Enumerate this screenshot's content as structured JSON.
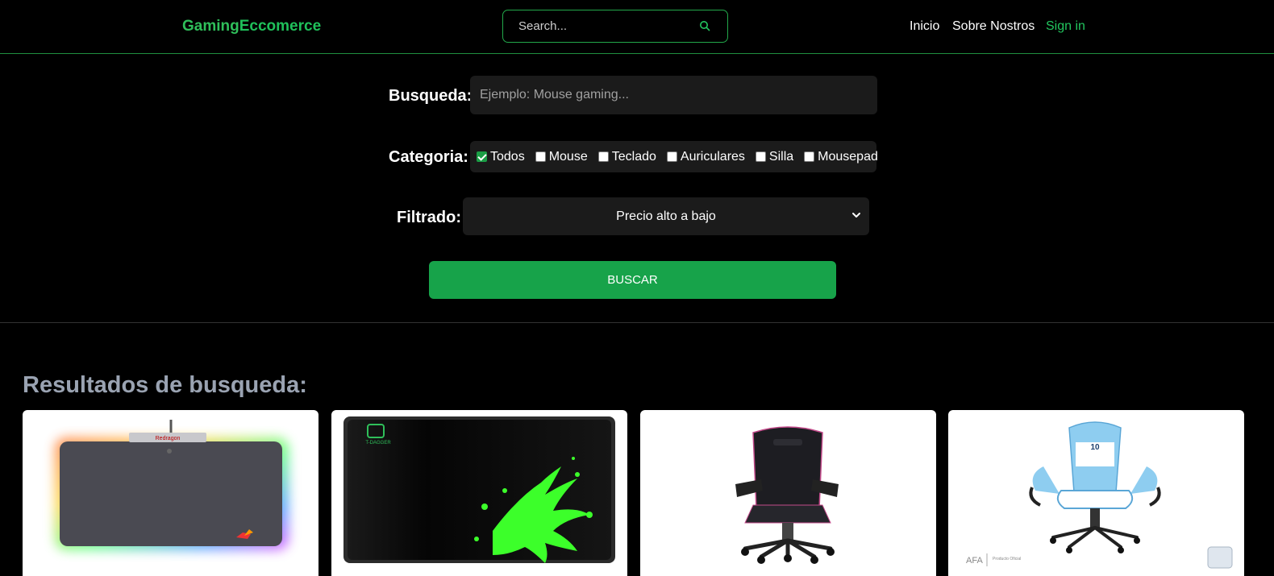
{
  "header": {
    "brand_part1": "Gaming",
    "brand_part2": "Eccomerce",
    "search_placeholder": "Search...",
    "nav": {
      "inicio": "Inicio",
      "sobre": "Sobre Nostros",
      "signin": "Sign in"
    }
  },
  "form": {
    "busqueda_label": "Busqueda:",
    "busqueda_placeholder": "Ejemplo: Mouse gaming...",
    "categoria_label": "Categoria:",
    "categories": [
      {
        "label": "Todos",
        "checked": true
      },
      {
        "label": "Mouse",
        "checked": false
      },
      {
        "label": "Teclado",
        "checked": false
      },
      {
        "label": "Auriculares",
        "checked": false
      },
      {
        "label": "Silla",
        "checked": false
      },
      {
        "label": "Mousepad",
        "checked": false
      }
    ],
    "filtrado_label": "Filtrado:",
    "filtrado_selected": "Precio alto a bajo",
    "submit_label": "BUSCAR"
  },
  "results": {
    "title": "Resultados de busqueda:",
    "products": [
      {
        "image": "redragon-rgb-mousepad",
        "logo_text": "Redragon"
      },
      {
        "image": "t-dagger-green-splash-mousepad",
        "logo_text": "T-DAGGER"
      },
      {
        "image": "black-pink-gaming-chair"
      },
      {
        "image": "afa-argentina-gaming-chair",
        "seal_text": "AFA",
        "tag_text": "Producto Oficial",
        "number": "10"
      }
    ]
  },
  "colors": {
    "accent": "#22c55e",
    "button": "#17a34a",
    "background": "#000000",
    "field": "#1b1b1b"
  }
}
